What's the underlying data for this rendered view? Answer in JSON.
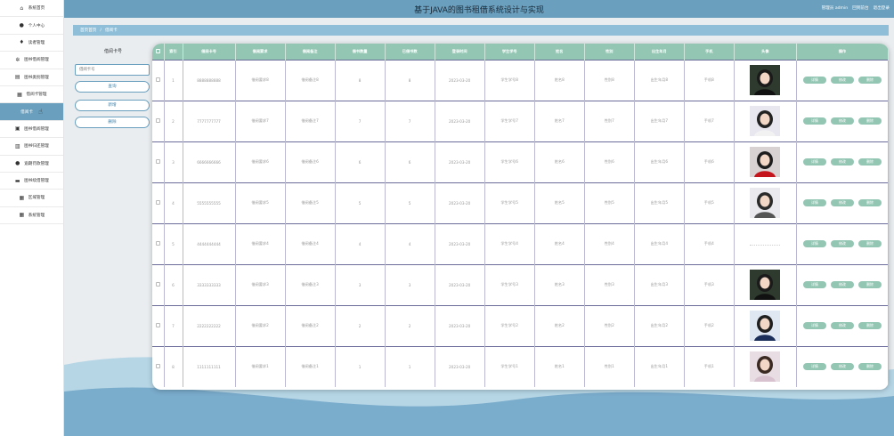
{
  "sidebar": {
    "items": [
      {
        "label": "系统首页",
        "icon": "home-icon",
        "glyph": "⌂"
      },
      {
        "label": "个人中心",
        "icon": "person-icon",
        "glyph": "●"
      },
      {
        "label": "读者管理",
        "icon": "location-pin-icon",
        "glyph": "♦"
      },
      {
        "label": "图书借阅管理",
        "icon": "settings-icon",
        "glyph": "✲"
      },
      {
        "label": "图书类别管理",
        "icon": "list-icon",
        "glyph": "▤"
      },
      {
        "label": "借阅卡管理",
        "icon": "grid-icon",
        "glyph": "▦"
      },
      {
        "label": "借阅卡",
        "icon": "",
        "glyph": "",
        "active": true
      },
      {
        "label": "图书借阅管理",
        "icon": "book-icon",
        "glyph": "▣"
      },
      {
        "label": "图书归还管理",
        "icon": "bar-chart-icon",
        "glyph": "▥"
      },
      {
        "label": "逾期罚款管理",
        "icon": "user-icon",
        "glyph": "●"
      },
      {
        "label": "图书续借管理",
        "icon": "folder-icon",
        "glyph": "▬"
      },
      {
        "label": "区域管理",
        "icon": "grid-icon",
        "glyph": "▦"
      },
      {
        "label": "系统管理",
        "icon": "grid-icon",
        "glyph": "▦"
      }
    ]
  },
  "header": {
    "title": "基于JAVA的图书租借系统设计与实现",
    "user": "管理员 admin",
    "back_label": "回到前台",
    "logout_label": "退出登录"
  },
  "breadcrumb": {
    "home": "首页首页",
    "sep": "/",
    "current": "借阅卡"
  },
  "search": {
    "label": "借阅卡号",
    "placeholder": "借阅卡号",
    "query_label": "查询",
    "add_label": "新增",
    "delete_label": "删除"
  },
  "table": {
    "columns": [
      "",
      "索引",
      "借阅卡号",
      "借阅要求",
      "借阅备注",
      "借书数量",
      "已借书数",
      "登录时间",
      "学生学号",
      "姓名",
      "性别",
      "出生年月",
      "手机",
      "头像",
      "操作"
    ],
    "rows": [
      {
        "index": "1",
        "card": "8888888888",
        "req": "借阅要求8",
        "note": "借阅备注8",
        "count": "8",
        "borrowed": "8",
        "date": "2023-03-20",
        "sid": "学生学号8",
        "name": "姓名8",
        "sex": "性别8",
        "birth": "出生年月8",
        "phone": "手机8",
        "avatar": "a"
      },
      {
        "index": "2",
        "card": "7777777777",
        "req": "借阅要求7",
        "note": "借阅备注7",
        "count": "7",
        "borrowed": "7",
        "date": "2023-03-20",
        "sid": "学生学号7",
        "name": "姓名7",
        "sex": "性别7",
        "birth": "出生年月7",
        "phone": "手机7",
        "avatar": "b"
      },
      {
        "index": "3",
        "card": "6666666666",
        "req": "借阅要求6",
        "note": "借阅备注6",
        "count": "6",
        "borrowed": "6",
        "date": "2023-03-20",
        "sid": "学生学号6",
        "name": "姓名6",
        "sex": "性别6",
        "birth": "出生年月6",
        "phone": "手机6",
        "avatar": "c"
      },
      {
        "index": "4",
        "card": "5555555555",
        "req": "借阅要求5",
        "note": "借阅备注5",
        "count": "5",
        "borrowed": "5",
        "date": "2023-03-20",
        "sid": "学生学号5",
        "name": "姓名5",
        "sex": "性别5",
        "birth": "出生年月5",
        "phone": "手机5",
        "avatar": "d"
      },
      {
        "index": "5",
        "card": "4444444444",
        "req": "借阅要求4",
        "note": "借阅备注4",
        "count": "4",
        "borrowed": "4",
        "date": "2023-03-20",
        "sid": "学生学号4",
        "name": "姓名4",
        "sex": "性别4",
        "birth": "出生年月4",
        "phone": "手机4",
        "avatar": ""
      },
      {
        "index": "6",
        "card": "3333333333",
        "req": "借阅要求3",
        "note": "借阅备注3",
        "count": "3",
        "borrowed": "3",
        "date": "2023-03-20",
        "sid": "学生学号3",
        "name": "姓名3",
        "sex": "性别3",
        "birth": "出生年月3",
        "phone": "手机3",
        "avatar": "a"
      },
      {
        "index": "7",
        "card": "2222222222",
        "req": "借阅要求2",
        "note": "借阅备注2",
        "count": "2",
        "borrowed": "2",
        "date": "2023-03-20",
        "sid": "学生学号2",
        "name": "姓名2",
        "sex": "性别2",
        "birth": "出生年月2",
        "phone": "手机2",
        "avatar": "e"
      },
      {
        "index": "8",
        "card": "1111111111",
        "req": "借阅要求1",
        "note": "借阅备注1",
        "count": "1",
        "borrowed": "1",
        "date": "2023-03-20",
        "sid": "学生学号1",
        "name": "姓名1",
        "sex": "性别1",
        "birth": "出生年月1",
        "phone": "手机1",
        "avatar": "f"
      }
    ],
    "actions": {
      "detail": "详情",
      "edit": "修改",
      "delete": "删除"
    }
  },
  "colors": {
    "accent": "#6a9fbd",
    "table_header": "#94c6b4",
    "wave_dark": "#7aaccb",
    "wave_light": "#b6d6e6"
  }
}
